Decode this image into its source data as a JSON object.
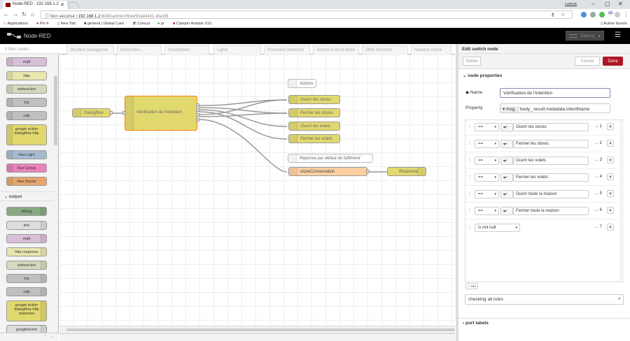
{
  "browser": {
    "tab_title": "Node-RED : 192.168.1.2",
    "user": "Ludovic",
    "url_security": "Non sécurisé",
    "url_host": "192.168.1.2",
    "url_path": ":8080/admin/#flow/93a4d401.4be2f8",
    "apps_label": "Applications",
    "bookmarks": [
      "Pin It",
      "New Tab",
      "general | Global Care",
      "Concur",
      "pr",
      "Camper Andiatx X10"
    ],
    "other_bookmarks": "Autres favoris"
  },
  "app": {
    "title": "Node-RED",
    "deploy_label": "Deploy"
  },
  "palette": {
    "filter_placeholder": "filter nodes",
    "nodes_top": [
      "mqtt",
      "http",
      "websocket",
      "tcp",
      "udp",
      "google action dialogflow http",
      "Hue Light",
      "Hue Group",
      "Hue Scene"
    ],
    "output_category": "output",
    "nodes_output": [
      "debug",
      "link",
      "mqtt",
      "http response",
      "websocket",
      "tcp",
      "udp",
      "google action dialogflow http response",
      "googlehome"
    ]
  },
  "workspace": {
    "tabs": [
      "Shutters Manageme",
      "Reminders",
      "SmartMeter",
      "Lights",
      "Presence Detection",
      "Smoke & flood detec",
      "SMS Services",
      "Network check"
    ],
    "nodes": {
      "dialogflow": "Dialogflow",
      "switch": "Vérification de l'intention",
      "actions": "Actions",
      "out1": "Ouvrir les stores",
      "out2": "Fermer les stores",
      "out3": "Ouvrir les volets",
      "out4": "Fermer les volets",
      "default_reply": "Réponse par défaut du fulfilment",
      "close": "closeConversation",
      "response": "Response"
    }
  },
  "sidebar": {
    "title": "Edit switch node",
    "delete_label": "Delete",
    "cancel_label": "Cancel",
    "done_label": "Done",
    "properties_section": "node properties",
    "name_label": "Name",
    "name_value": "Vérification de l'intention",
    "property_label": "Property",
    "property_type": "msg.",
    "property_value": "body_.result.metadata.intentName",
    "rules": [
      {
        "op": "==",
        "value": "Ouvrir les stores",
        "out": "→ 1"
      },
      {
        "op": "==",
        "value": "Fermer les stores",
        "out": "→ 2"
      },
      {
        "op": "==",
        "value": "Ouvrir les volets",
        "out": "→ 3"
      },
      {
        "op": "==",
        "value": "Fermer les volets",
        "out": "→ 4"
      },
      {
        "op": "==",
        "value": "Ouvrir toute la maison",
        "out": "→ 5"
      },
      {
        "op": "==",
        "value": "Fermer toute la maison",
        "out": "→ 6"
      },
      {
        "op": "is not null",
        "value": "",
        "out": "→ 7"
      }
    ],
    "add_label": "add",
    "checking_mode": "checking all rules",
    "port_labels_section": "port labels"
  },
  "colors": {
    "header_bg": "#000000",
    "done_btn": "#ad1625",
    "node_yellow": "#e2d96e",
    "node_switch": "#e2d96e",
    "node_orange": "#fdd0a2",
    "hue_light": "#a6bbcf",
    "hue_group": "#e983b8",
    "hue_scene": "#e6a56d"
  }
}
